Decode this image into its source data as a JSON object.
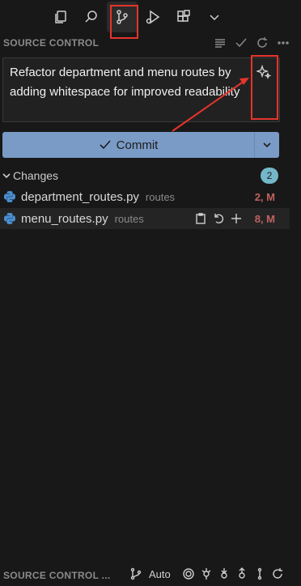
{
  "toolbar": {
    "icons": [
      "copy-icon",
      "search-icon",
      "source-control-icon",
      "run-debug-icon",
      "extensions-icon",
      "chevron-down-icon"
    ]
  },
  "section": {
    "title": "SOURCE CONTROL"
  },
  "commit_message": {
    "value": "Refactor department and menu routes by adding whitespace for improved readability"
  },
  "commit_button": {
    "label": "Commit"
  },
  "changes": {
    "label": "Changes",
    "count": "2",
    "files": [
      {
        "name": "department_routes.py",
        "dir": "routes",
        "status": "2, M"
      },
      {
        "name": "menu_routes.py",
        "dir": "routes",
        "status": "8, M"
      }
    ]
  },
  "bottom": {
    "title": "SOURCE CONTROL ...",
    "auto_label": "Auto"
  },
  "colors": {
    "accent": "#7a9bc6",
    "highlight": "#e5342c",
    "badge": "#74b7c9",
    "modified": "#c0625f"
  }
}
